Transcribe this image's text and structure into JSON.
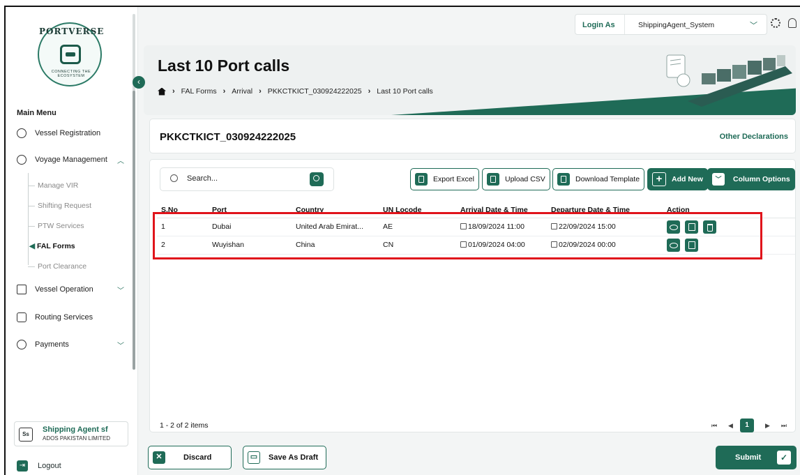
{
  "sidebar": {
    "main_menu_title": "Main Menu",
    "collapse_icon": "chevron-left-icon",
    "logo": {
      "ring_text": "PORTVERSE",
      "tagline": "CONNECTING THE ECOSYSTEM"
    },
    "items": [
      {
        "label": "Vessel Registration",
        "icon": "ship-wheel-icon"
      },
      {
        "label": "Voyage Management",
        "icon": "compass-icon",
        "chevron": "^"
      },
      {
        "label": "Vessel Operation",
        "icon": "ship-icon",
        "chevron": "v"
      },
      {
        "label": "Routing Services",
        "icon": "route-icon"
      },
      {
        "label": "Payments",
        "icon": "payment-icon",
        "chevron": "v"
      }
    ],
    "sub_items": [
      {
        "label": "Manage VIR"
      },
      {
        "label": "Shifting Request"
      },
      {
        "label": "PTW Services"
      },
      {
        "label": "FAL Forms",
        "active": true
      },
      {
        "label": "Port Clearance"
      }
    ],
    "user": {
      "initials": "Ss",
      "name": "Shipping Agent sf",
      "org": "ADOS PAKISTAN LIMITED"
    },
    "logout_label": "Logout"
  },
  "topbar": {
    "login_as_label": "Login As",
    "login_as_value": "ShippingAgent_System"
  },
  "header": {
    "title": "Last 10 Port calls",
    "breadcrumb": [
      "FAL Forms",
      "Arrival",
      "PKKCTKICT_030924222025",
      "Last 10 Port calls"
    ]
  },
  "record": {
    "title": "PKKCTKICT_030924222025",
    "other_declarations": "Other Declarations"
  },
  "toolbar": {
    "search_placeholder": "Search...",
    "export_excel": "Export Excel",
    "upload_csv": "Upload CSV",
    "download_template": "Download Template",
    "add_new": "Add New",
    "column_options": "Column Options"
  },
  "table": {
    "columns": [
      "S.No",
      "Port",
      "Country",
      "UN Locode",
      "Arrival Date & Time",
      "Departure Date & Time",
      "Action"
    ],
    "rows": [
      {
        "sno": "1",
        "port": "Dubai",
        "country": "United Arab Emirat...",
        "locode": "AE",
        "arrival": "18/09/2024 11:00",
        "departure": "22/09/2024 15:00"
      },
      {
        "sno": "2",
        "port": "Wuyishan",
        "country": "China",
        "locode": "CN",
        "arrival": "01/09/2024 04:00",
        "departure": "02/09/2024 00:00"
      }
    ],
    "pager_info": "1 - 2 of 2 items",
    "current_page": "1"
  },
  "footer": {
    "discard": "Discard",
    "save_draft": "Save As Draft",
    "submit": "Submit"
  },
  "colors": {
    "brand": "#1f6b57",
    "highlight": "#e0141b"
  }
}
